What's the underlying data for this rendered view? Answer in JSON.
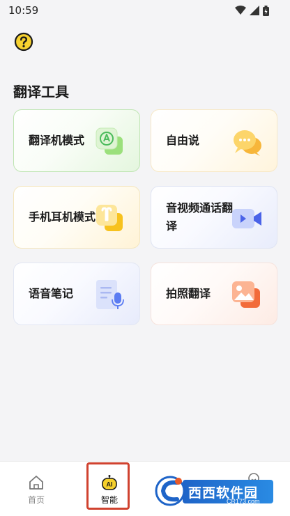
{
  "status_bar": {
    "time": "10:59",
    "icons": [
      "wifi-icon",
      "cell-signal-icon",
      "battery-icon"
    ]
  },
  "header": {
    "help_icon": "question-circle-icon"
  },
  "section": {
    "title": "翻译工具"
  },
  "cards": [
    {
      "id": "translator",
      "label": "翻译机模式",
      "icon": "translator-device-icon",
      "accent": "#3fba5a"
    },
    {
      "id": "free-talk",
      "label": "自由说",
      "icon": "chat-bubbles-icon",
      "accent": "#f5a623"
    },
    {
      "id": "earphone",
      "label": "手机耳机模式",
      "icon": "earbuds-icon",
      "accent": "#f5b400"
    },
    {
      "id": "call",
      "label": "音视频通话翻译",
      "icon": "video-call-icon",
      "accent": "#4a63e8"
    },
    {
      "id": "voice-notes",
      "label": "语音笔记",
      "icon": "voice-note-icon",
      "accent": "#5b7cf2"
    },
    {
      "id": "photo",
      "label": "拍照翻译",
      "icon": "photo-icon",
      "accent": "#f26b3a"
    }
  ],
  "tab_bar": {
    "tabs": [
      {
        "label": "首页",
        "icon": "home-icon",
        "selected": false
      },
      {
        "label": "智能",
        "icon": "ai-robot-icon",
        "selected": true
      },
      {
        "label": "",
        "icon": "profile-icon",
        "selected": false
      }
    ]
  },
  "watermark": {
    "text": "西西软件园",
    "domain": "CR173.com"
  },
  "colors": {
    "background": "#f4f4f6",
    "highlight_box": "#d0422f",
    "ai_yellow": "#f5d02c"
  }
}
